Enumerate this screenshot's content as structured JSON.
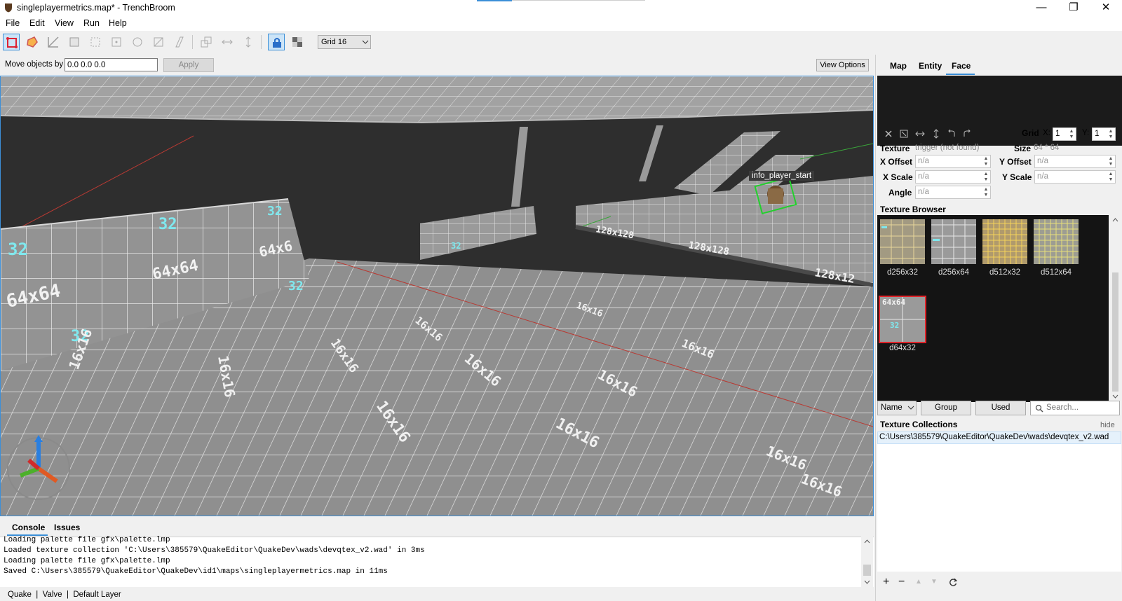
{
  "window": {
    "title": "singleplayermetrics.map* - TrenchBroom",
    "minimize_glyph": "—",
    "maximize_glyph": "❐",
    "close_glyph": "✕"
  },
  "menu": {
    "items": [
      "File",
      "Edit",
      "View",
      "Run",
      "Help"
    ]
  },
  "toolbar": {
    "grid_value": "Grid 16"
  },
  "move_bar": {
    "label": "Move objects by",
    "input_value": "0.0 0.0 0.0",
    "apply_label": "Apply",
    "view_options_label": "View Options"
  },
  "viewport": {
    "entity_label": "info_player_start",
    "wall_texture_labels": [
      "64x64",
      "64x64",
      "64x6",
      "32",
      "32",
      "32",
      "32",
      "32",
      "32"
    ],
    "floor_texture_labels": [
      "128x128",
      "128x128",
      "128x12"
    ],
    "floor_rotated_labels": [
      "16x16",
      "16x16",
      "16x16",
      "16x16",
      "16x16",
      "16x16",
      "16x16",
      "16x16",
      "16x16",
      "16x16",
      "16x16",
      "16x16"
    ]
  },
  "console": {
    "tabs": [
      "Console",
      "Issues"
    ],
    "lines": [
      "Loading palette file gfx\\palette.lmp",
      "Loaded texture collection 'C:\\Users\\385579\\QuakeEditor\\QuakeDev\\wads\\devqtex_v2.wad' in 3ms",
      "Loading palette file gfx\\palette.lmp",
      "Saved C:\\Users\\385579\\QuakeEditor\\QuakeDev\\id1\\maps\\singleplayermetrics.map in 11ms"
    ]
  },
  "status_bar": {
    "text": "Quake  |  Valve  |  Default Layer"
  },
  "inspector": {
    "tabs": [
      "Map",
      "Entity",
      "Face"
    ],
    "active_tab": "Face",
    "grid_label": "Grid",
    "grid_x_label": "X:",
    "grid_x_value": "1",
    "grid_y_label": "Y:",
    "grid_y_value": "1",
    "texture_label": "Texture",
    "texture_value": "trigger (not found)",
    "size_label": "Size",
    "size_value": "64 * 64",
    "x_offset_label": "X Offset",
    "x_offset_value": "n/a",
    "y_offset_label": "Y Offset",
    "y_offset_value": "n/a",
    "x_scale_label": "X Scale",
    "x_scale_value": "n/a",
    "y_scale_label": "Y Scale",
    "y_scale_value": "n/a",
    "angle_label": "Angle",
    "angle_value": "n/a"
  },
  "texture_browser": {
    "title": "Texture Browser",
    "textures": [
      {
        "name": "d256x32",
        "thumb_label": ""
      },
      {
        "name": "d256x64",
        "thumb_label": ""
      },
      {
        "name": "d512x32",
        "thumb_label": ""
      },
      {
        "name": "d512x64",
        "thumb_label": ""
      },
      {
        "name": "d64x32",
        "thumb_label": "64x64",
        "thumb_label2": "32",
        "selected": true
      }
    ],
    "sort_value": "Name",
    "group_label": "Group",
    "used_label": "Used",
    "search_placeholder": "Search..."
  },
  "texture_collections": {
    "title": "Texture Collections",
    "hide_label": "hide",
    "items": [
      "C:\\Users\\385579\\QuakeEditor\\QuakeDev\\wads\\devqtex_v2.wad"
    ]
  },
  "colors": {
    "accent": "#3b8fd8",
    "selected_texture_border": "#e0242a",
    "entity_selection": "#22d02c",
    "texture_label_cyan": "#7fe8ee"
  }
}
